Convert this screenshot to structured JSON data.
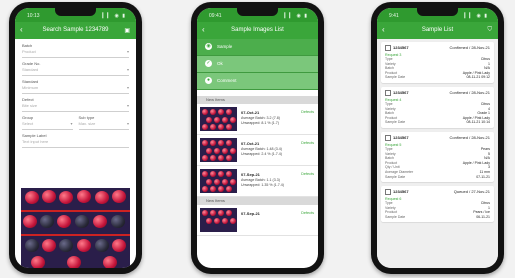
{
  "phone1": {
    "status_time": "10:13",
    "status_signal": "▎▎ ◉ ▮",
    "title": "Search Sample 1234789",
    "form": [
      {
        "label": "Batch",
        "value": "Product"
      },
      {
        "label": "Grade No.",
        "value": "Standard"
      },
      {
        "label": "Standard",
        "value": "Minimum"
      },
      {
        "label": "Defect",
        "value": "Bite size"
      }
    ],
    "row": [
      {
        "label": "Group",
        "value": "Select"
      },
      {
        "label": "Sub type",
        "value": "Max. size"
      }
    ],
    "last": {
      "label": "Sample Label",
      "value": "Text input here"
    }
  },
  "phone2": {
    "status_time": "09:41",
    "status_signal": "▎▎ ◉ ▮",
    "title": "Sample Images List",
    "panels": [
      {
        "icon": "◉",
        "text": "Sample"
      },
      {
        "icon": "✓",
        "text": "Ok"
      },
      {
        "icon": "●",
        "text": "Comment"
      }
    ],
    "sections": [
      "New Items",
      "New Items"
    ],
    "items": [
      {
        "t1": "07-Oct-21",
        "t2": "Average Batch: 3.2 (7.8)",
        "t3": "Unwrapped: 8.1 % (1.7)",
        "st": "Defects"
      },
      {
        "t1": "07-Oct-21",
        "t2": "Average Batch: 1.48 (3.4)",
        "t3": "Unwrapped: 2.4 % (1.7.4)",
        "st": "Defects"
      },
      {
        "t1": "07-Sep-21",
        "t2": "Average Batch: 1.1 (3.3)",
        "t3": "Unwrapped: 1.35 % (1.7.4)",
        "st": "Defects"
      },
      {
        "t1": "07-Sep-21",
        "t2": "",
        "t3": "",
        "st": "Defects"
      }
    ]
  },
  "phone3": {
    "status_time": "9:41",
    "status_signal": "▎▎ ◉ ▮",
    "title": "Sample List",
    "cards": [
      {
        "id": "1234567",
        "right": "Confirmed / 28-Nov-21",
        "tag": "Request 3",
        "rows": [
          [
            "Type",
            "Citrus"
          ],
          [
            "Variety",
            "1"
          ],
          [
            "Batch",
            "N/A"
          ],
          [
            "Product",
            "Apple / Pink Lady"
          ],
          [
            "Sample Date",
            "08-11-21 09:12"
          ]
        ]
      },
      {
        "id": "1234567",
        "right": "Confirmed / 28-Nov-21",
        "tag": "Request 4",
        "rows": [
          [
            "Type",
            "Citrus"
          ],
          [
            "Variety",
            "4"
          ],
          [
            "Batch",
            "Grade 1"
          ],
          [
            "Product",
            "Apple / Pink Lady"
          ],
          [
            "Sample Date",
            "08-11-21 10:14"
          ]
        ]
      },
      {
        "id": "1234567",
        "right": "Confirmed / 28-Nov-21",
        "tag": "Request 5",
        "rows": [
          [
            "Type",
            "Pears"
          ],
          [
            "Variety",
            "5"
          ],
          [
            "Batch",
            "N/A"
          ],
          [
            "Product",
            "Apple / Pink Lady"
          ],
          [
            "Qty / Unit",
            "3"
          ],
          [
            "Average Diameter",
            "11 mm"
          ],
          [
            "Sample Date",
            "07-11-21"
          ]
        ]
      },
      {
        "id": "1234567",
        "right": "Queued / 27-Nov-21",
        "tag": "Request 6",
        "rows": [
          [
            "Type",
            "Citrus"
          ],
          [
            "Variety",
            "1"
          ],
          [
            "Product",
            "Pears / Ice"
          ],
          [
            "Sample Date",
            "06-11-21"
          ]
        ]
      }
    ]
  },
  "colors": {
    "accent": "#3aa63a",
    "header": "#2f9a2f"
  }
}
